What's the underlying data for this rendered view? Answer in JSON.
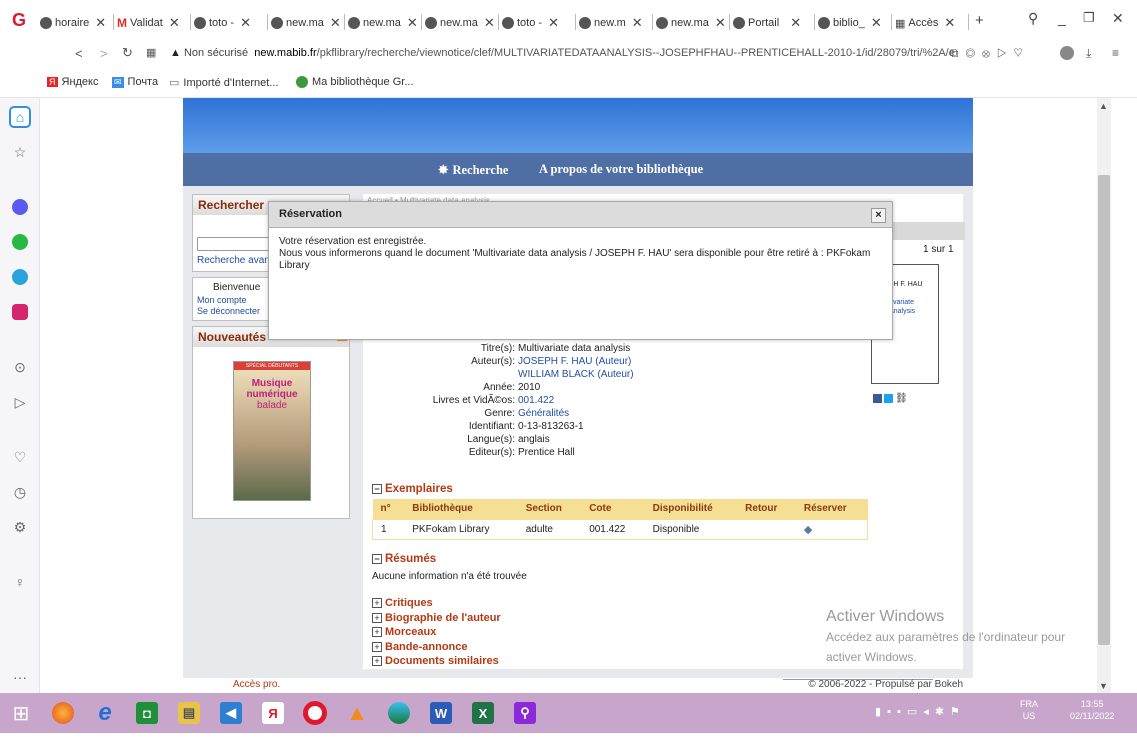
{
  "browser": {
    "tabs": [
      {
        "label": "horaire",
        "icon": "globe-icon"
      },
      {
        "label": "Validat",
        "icon": "gmail-icon"
      },
      {
        "label": "toto - ",
        "icon": "globe-icon"
      },
      {
        "label": "new.ma",
        "icon": "globe-icon"
      },
      {
        "label": "new.ma",
        "icon": "globe-icon"
      },
      {
        "label": "new.ma",
        "icon": "globe-icon"
      },
      {
        "label": "toto - ",
        "icon": "globe-icon"
      },
      {
        "label": "new.m",
        "icon": "globe-icon"
      },
      {
        "label": "new.ma",
        "icon": "globe-icon"
      },
      {
        "label": "Portail",
        "icon": "globe-icon"
      },
      {
        "label": "biblio_",
        "icon": "globe-icon"
      },
      {
        "label": "Accès",
        "icon": "grid-icon"
      }
    ],
    "new_tab": "+",
    "security_label": "Non sécurisé",
    "url_host": "new.mabib.fr",
    "url_path": "/pkflibrary/recherche/viewnotice/clef/MULTIVARIATEDATAANALYSIS--JOSEPHFHAU--PRENTICEHALL-2010-1/id/28079/tri/%2A/e",
    "bookmarks": [
      "Яндекс",
      "Почта",
      "Importé d'Internet...",
      "Ma bibliothèque Gr..."
    ]
  },
  "site": {
    "nav": [
      "Recherche",
      "A propos de votre bibliothèque"
    ],
    "search_box_title": "Rechercher",
    "search_advanced": "Recherche avan",
    "welcome": "Bienvenue",
    "my_account": "Mon compte",
    "logout": "Se déconnecter",
    "news_title": "Nouveautés",
    "book_cover_lines": [
      "SPÉCIAL DÉBUTANTS",
      "Musique numérique",
      "balade"
    ],
    "breadcrumb_hint": "Accueil • Multivariate data analysis",
    "pager": "1 sur 1",
    "cover_text": [
      "EPH F. HAU",
      "ultivariate",
      "a analysis"
    ]
  },
  "notice": {
    "fields": [
      {
        "label": "Titre(s):",
        "value": "Multivariate data analysis",
        "link": false
      },
      {
        "label": "Auteur(s):",
        "value": "JOSEPH F. HAU (Auteur)",
        "link": true
      },
      {
        "label": "",
        "value": "WILLIAM BLACK (Auteur)",
        "link": true
      },
      {
        "label": "Année:",
        "value": "2010",
        "link": false
      },
      {
        "label": "Livres et VidÃ©os:",
        "value": "001.422",
        "link": true
      },
      {
        "label": "Genre:",
        "value": "Généralités",
        "link": true
      },
      {
        "label": "Identifiant:",
        "value": "0-13-813263-1",
        "link": false
      },
      {
        "label": "Langue(s):",
        "value": "anglais",
        "link": false
      },
      {
        "label": "Editeur(s):",
        "value": "Prentice Hall",
        "link": false
      }
    ],
    "exemplaires_title": "Exemplaires",
    "columns": [
      "n°",
      "Bibliothèque",
      "Section",
      "Cote",
      "Disponibilité",
      "Retour",
      "Réserver"
    ],
    "rows": [
      {
        "n": "1",
        "bib": "PKFokam Library",
        "section": "adulte",
        "cote": "001.422",
        "dispo": "Disponible",
        "retour": ""
      }
    ],
    "resumes_title": "Résumés",
    "resumes_empty": "Aucune information n'a été trouvée",
    "sections": [
      "Critiques",
      "Biographie de l'auteur",
      "Morceaux",
      "Bande-annonce",
      "Documents similaires"
    ]
  },
  "dialog": {
    "title": "Réservation",
    "close": "×",
    "line1": "Votre réservation est enregistrée.",
    "line2": "Nous vous informerons quand le document 'Multivariate data analysis / JOSEPH F. HAU' sera disponible pour être retiré à : PKFokam Library"
  },
  "footer": {
    "left": "Accès pro.",
    "right": "© 2006-2022 - Propulsé par Bokeh"
  },
  "watermark": {
    "title": "Activer Windows",
    "line1": "Accédez aux paramètres de l'ordinateur pour",
    "line2": "activer Windows."
  },
  "taskbar": {
    "lang": "FRA",
    "region": "US",
    "time": "13:55",
    "date": "02/11/2022"
  }
}
